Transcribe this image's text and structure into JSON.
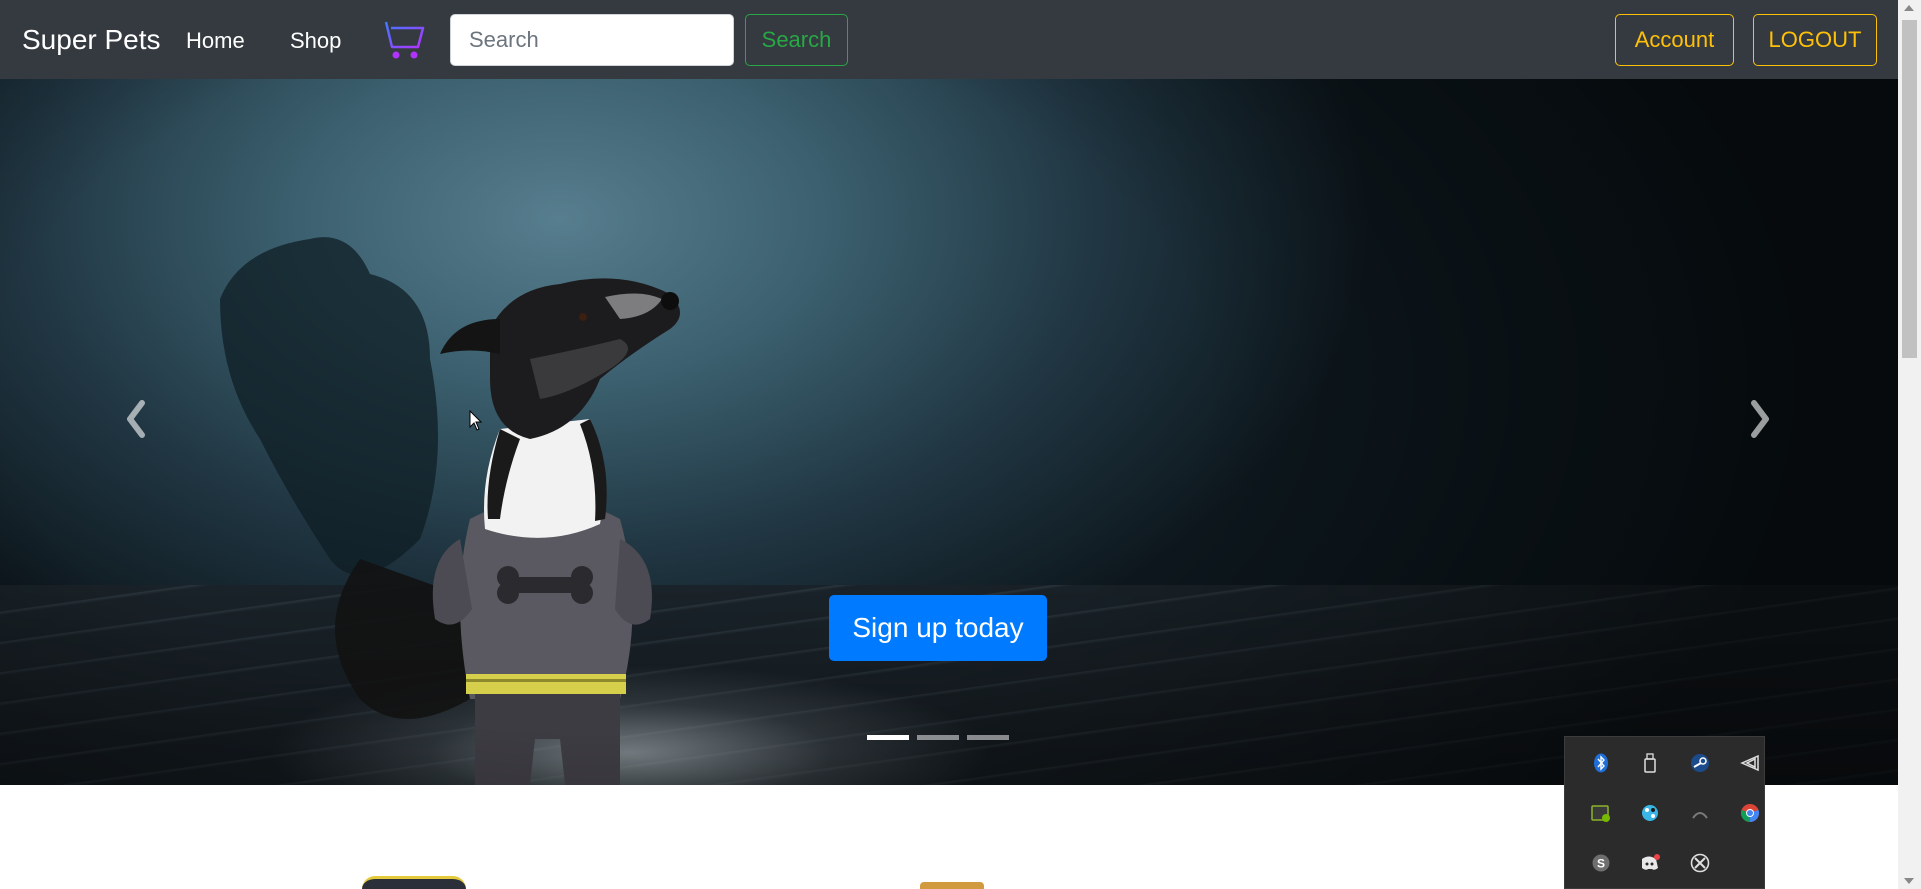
{
  "navbar": {
    "brand": "Super Pets",
    "links": [
      {
        "label": "Home"
      },
      {
        "label": "Shop"
      }
    ],
    "cart_icon": "shopping-cart-icon",
    "search": {
      "placeholder": "Search",
      "value": "",
      "button_label": "Search"
    },
    "account_label": "Account",
    "logout_label": "LOGOUT"
  },
  "hero": {
    "cta_label": "Sign up today",
    "slide_count": 3,
    "active_slide": 1,
    "prev_icon": "chevron-left-icon",
    "next_icon": "chevron-right-icon"
  },
  "system_tray": {
    "icons": [
      "bluetooth-icon",
      "usb-drive-icon",
      "steam-icon",
      "visual-studio-icon",
      "nvidia-icon",
      "color-palette-icon",
      "wifi-hidden-icon",
      "chrome-icon",
      "skype-icon",
      "discord-icon",
      "xbox-icon"
    ]
  },
  "colors": {
    "navbar_bg": "#343a40",
    "success": "#28a745",
    "warning": "#ffc107",
    "primary": "#007bff",
    "cart_accent": "#8a3cff"
  }
}
